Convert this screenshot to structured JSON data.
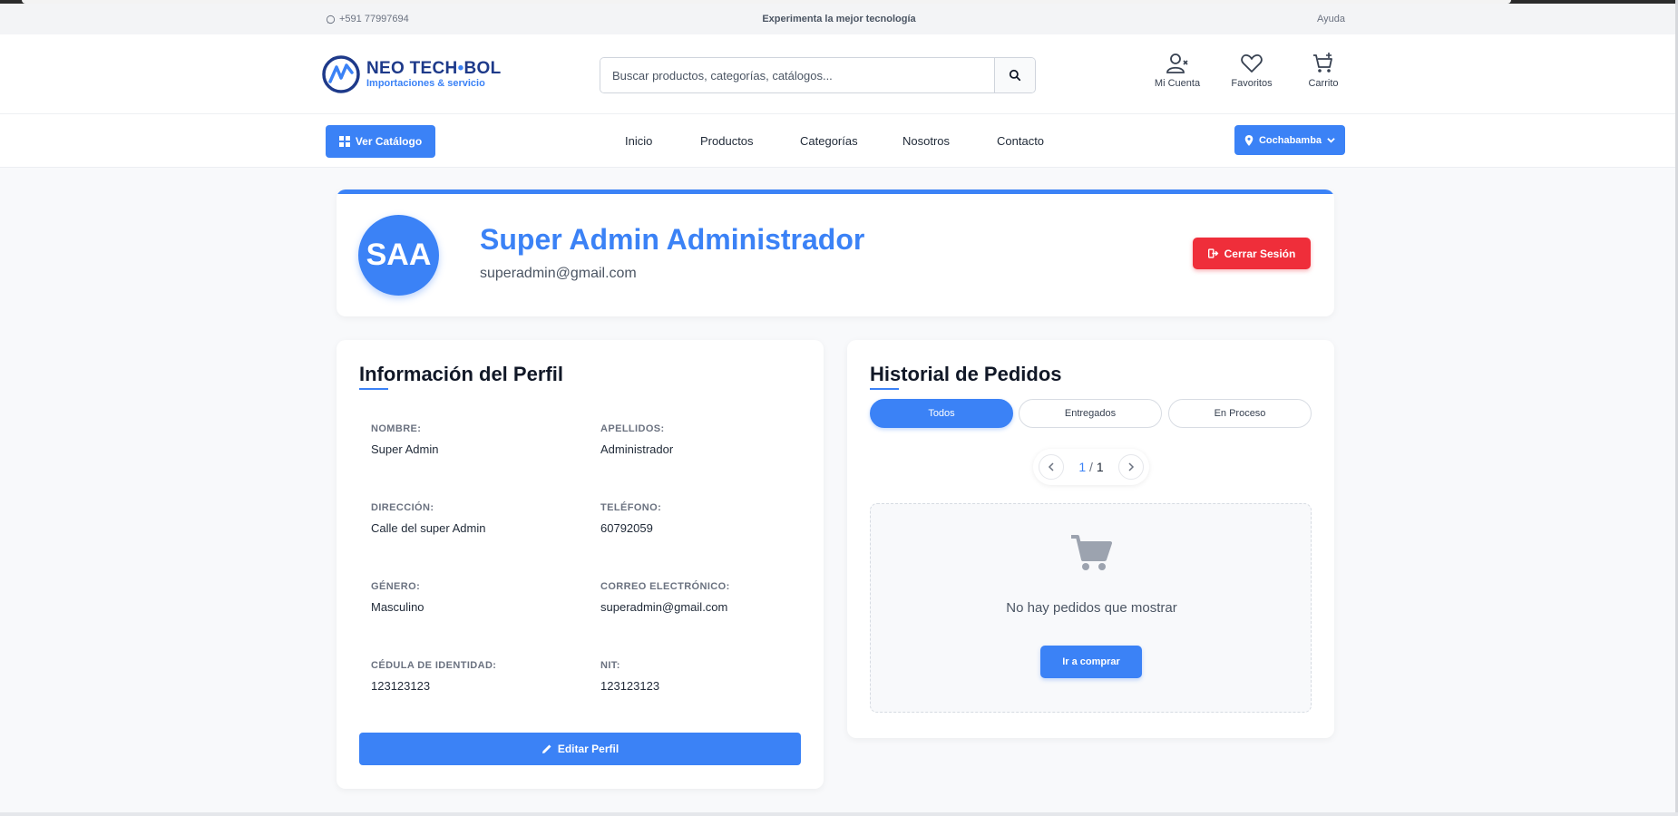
{
  "topbar": {
    "phone": "+591 77997694",
    "tagline": "Experimenta la mejor tecnología",
    "help": "Ayuda"
  },
  "header": {
    "logo": {
      "brand_left": "NEO TECH",
      "brand_right": "BOL",
      "subtitle": "Importaciones & servicio"
    },
    "search": {
      "placeholder": "Buscar productos, categorías, catálogos..."
    },
    "icons": [
      {
        "name": "user-icon",
        "label": "Mi Cuenta"
      },
      {
        "name": "heart-icon",
        "label": "Favoritos"
      },
      {
        "name": "cart-icon",
        "label": "Carrito"
      }
    ]
  },
  "nav": {
    "catalog_label": "Ver Catálogo",
    "links": [
      "Inicio",
      "Productos",
      "Categorías",
      "Nosotros",
      "Contacto"
    ],
    "city": "Cochabamba"
  },
  "profile": {
    "initials": "SAA",
    "full_name": "Super Admin Administrador",
    "email": "superadmin@gmail.com",
    "logout_label": "Cerrar Sesión"
  },
  "info": {
    "title": "Información del Perfil",
    "fields": [
      {
        "label": "NOMBRE:",
        "value": "Super Admin"
      },
      {
        "label": "APELLIDOS:",
        "value": "Administrador"
      },
      {
        "label": "DIRECCIÓN:",
        "value": "Calle del super Admin"
      },
      {
        "label": "TELÉFONO:",
        "value": "60792059"
      },
      {
        "label": "GÉNERO:",
        "value": "Masculino"
      },
      {
        "label": "CORREO ELECTRÓNICO:",
        "value": "superadmin@gmail.com"
      },
      {
        "label": "CÉDULA DE IDENTIDAD:",
        "value": "123123123"
      },
      {
        "label": "NIT:",
        "value": "123123123"
      }
    ],
    "edit_label": "Editar Perfil"
  },
  "orders": {
    "title": "Historial de Pedidos",
    "tabs": [
      {
        "label": "Todos",
        "active": true
      },
      {
        "label": "Entregados",
        "active": false
      },
      {
        "label": "En Proceso",
        "active": false
      }
    ],
    "pager": {
      "current": "1",
      "separator": "/",
      "total": "1"
    },
    "empty_message": "No hay pedidos que mostrar",
    "shop_label": "Ir a comprar"
  },
  "colors": {
    "primary": "#3b82f6",
    "danger": "#ef2e3a",
    "brand_dark": "#1e3a8a"
  }
}
